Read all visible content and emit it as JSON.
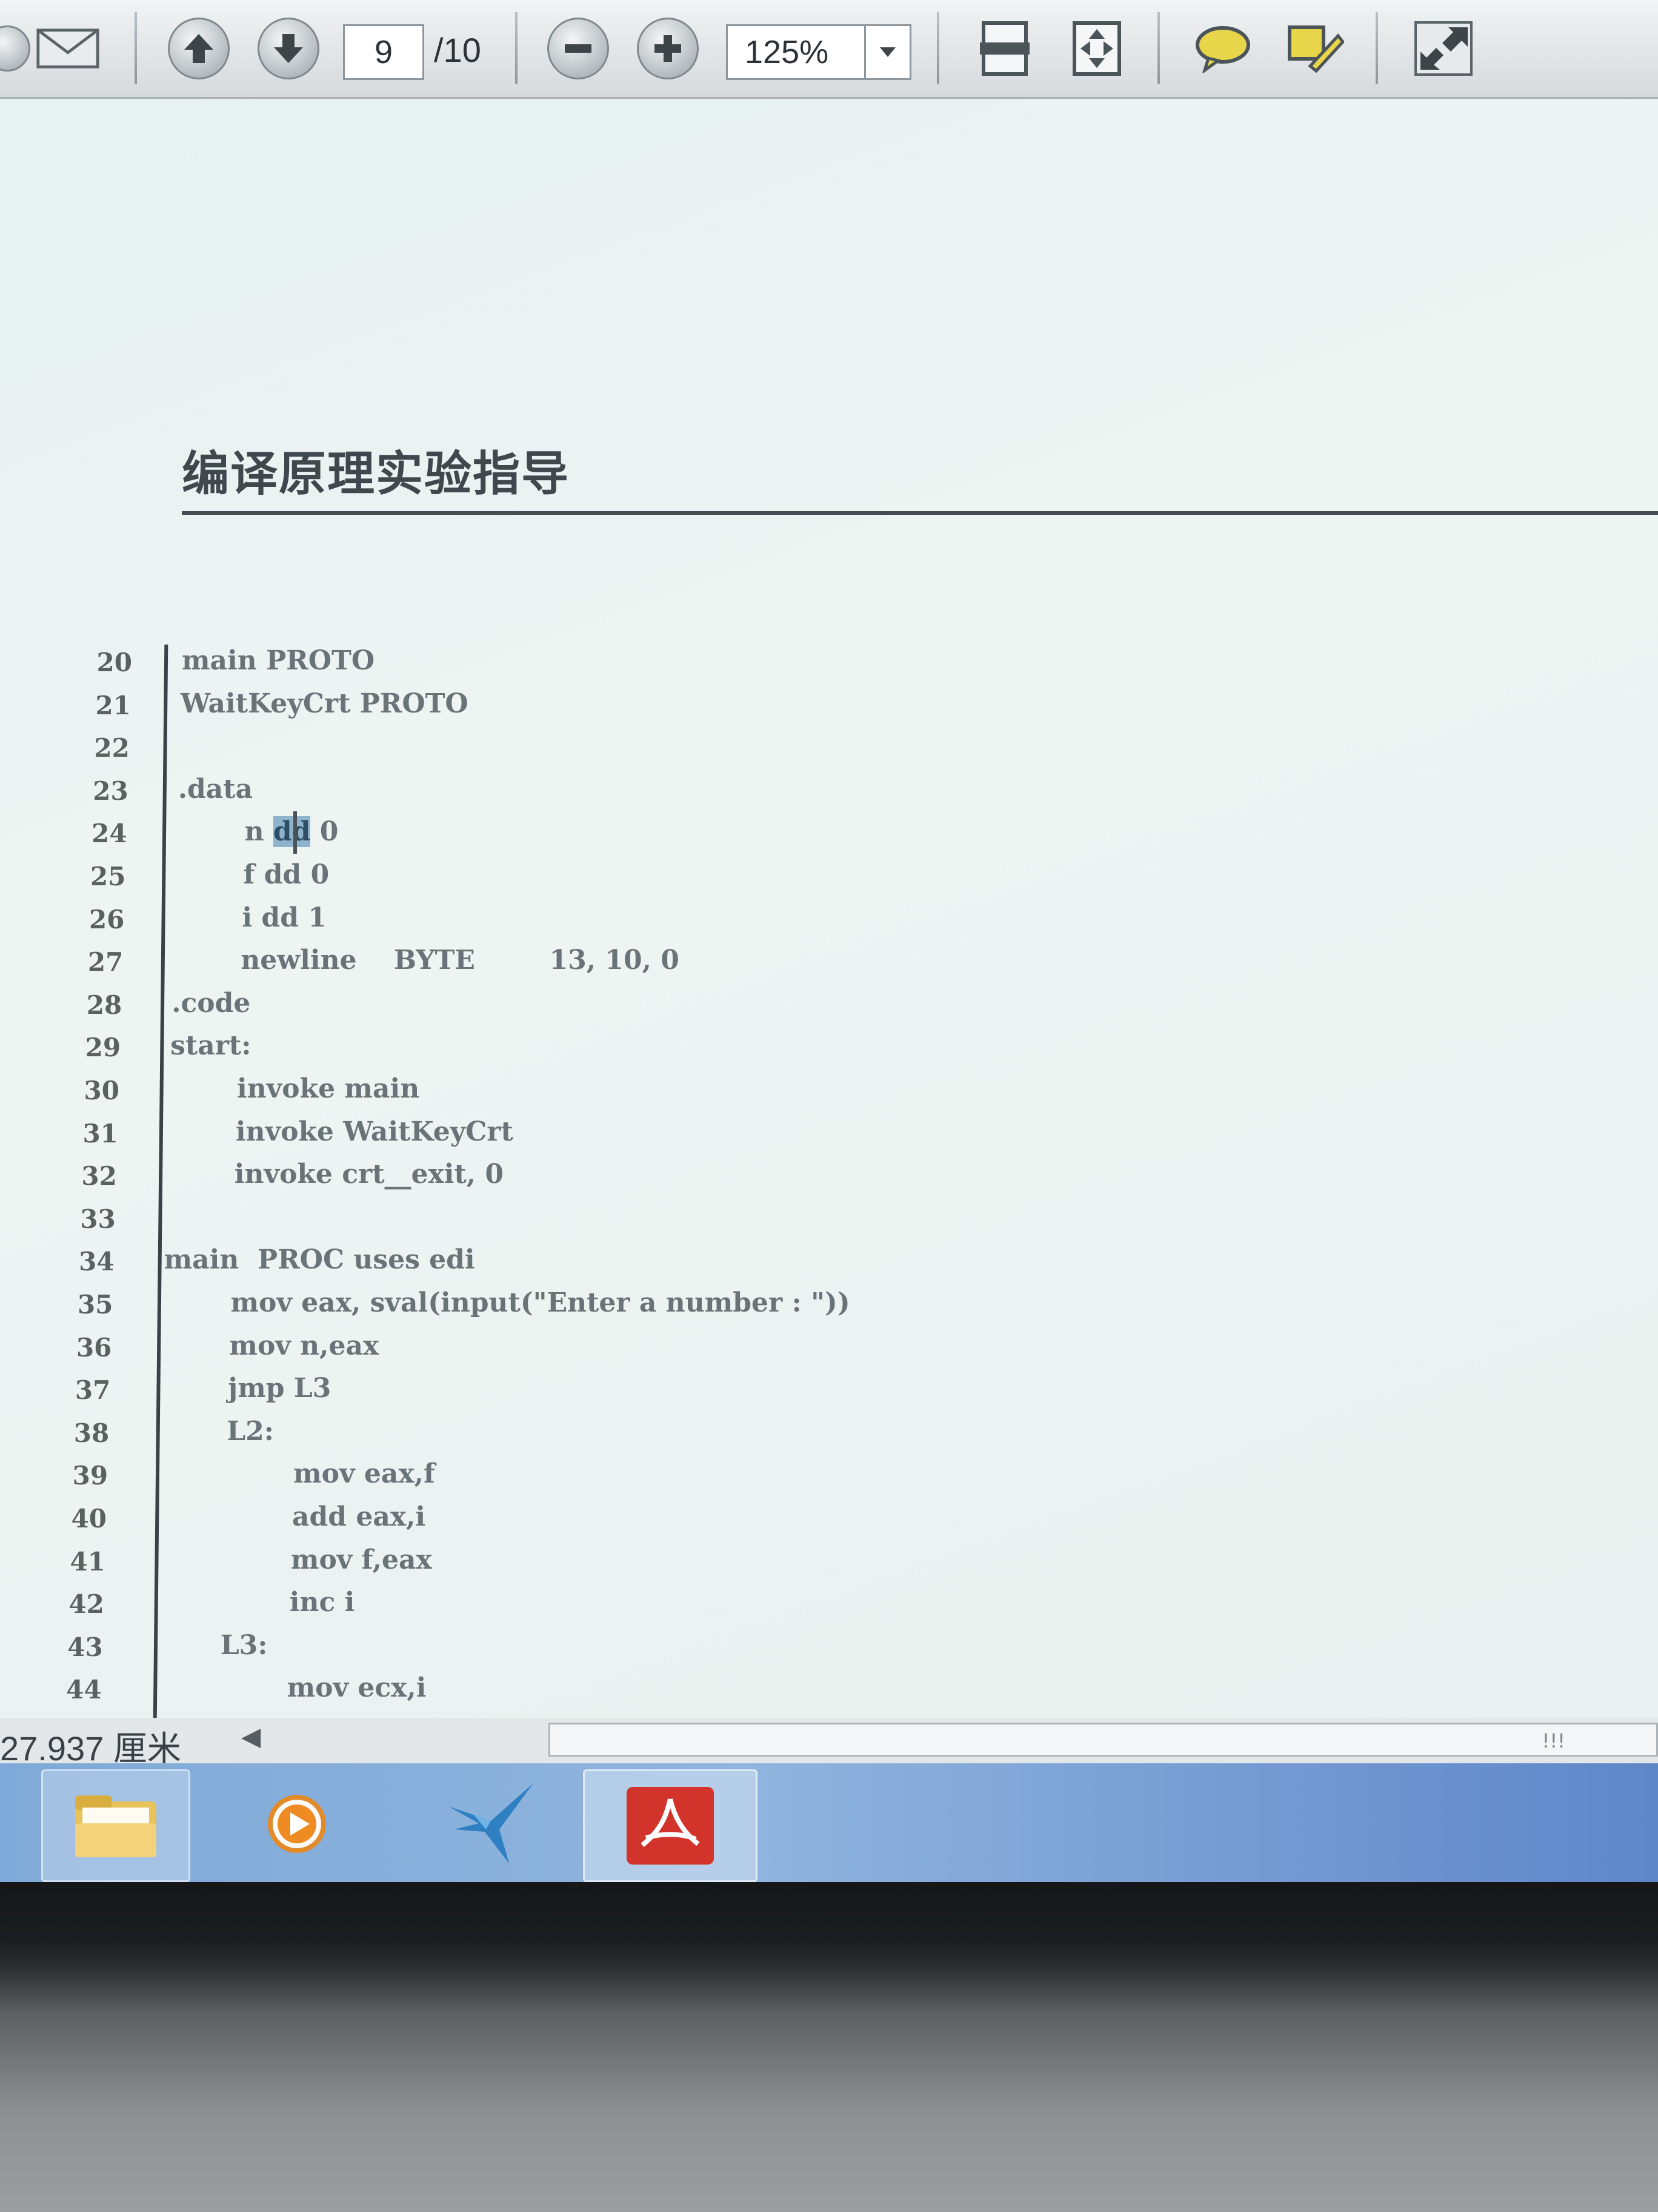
{
  "toolbar": {
    "page_current": "9",
    "page_total": "/10",
    "zoom": "125%",
    "icons": [
      "mail-icon",
      "page-up-icon",
      "page-down-icon",
      "zoom-out-icon",
      "zoom-in-icon",
      "fit-width-icon",
      "fit-page-icon",
      "comment-icon",
      "highlight-icon",
      "fullscreen-icon"
    ]
  },
  "document": {
    "header_title": "编译原理实验指导",
    "code_lines": [
      {
        "num": "20",
        "text": "main PROTO"
      },
      {
        "num": "21",
        "text": "WaitKeyCrt PROTO"
      },
      {
        "num": "22",
        "text": ""
      },
      {
        "num": "23",
        "text": ".data"
      },
      {
        "num": "24",
        "pre": "n ",
        "hl": "dd",
        "post": " 0"
      },
      {
        "num": "25",
        "text": "f dd 0"
      },
      {
        "num": "26",
        "text": "i dd 1"
      },
      {
        "num": "27",
        "text": "newline    BYTE        13, 10, 0"
      },
      {
        "num": "28",
        "text": ".code"
      },
      {
        "num": "29",
        "text": "start:"
      },
      {
        "num": "30",
        "text": "invoke main"
      },
      {
        "num": "31",
        "text": "invoke WaitKeyCrt"
      },
      {
        "num": "32",
        "text": "invoke crt__exit, 0"
      },
      {
        "num": "33",
        "text": ""
      },
      {
        "num": "34",
        "text": "main  PROC uses edi"
      },
      {
        "num": "35",
        "text": "mov eax, sval(input(\"Enter a number : \"))"
      },
      {
        "num": "36",
        "text": "mov n,eax"
      },
      {
        "num": "37",
        "text": "jmp L3"
      },
      {
        "num": "38",
        "text": "L2:"
      },
      {
        "num": "39",
        "text": "mov eax,f"
      },
      {
        "num": "40",
        "text": "add eax,i"
      },
      {
        "num": "41",
        "text": "mov f,eax"
      },
      {
        "num": "42",
        "text": "inc i"
      },
      {
        "num": "43",
        "text": "L3:"
      },
      {
        "num": "44",
        "text": "mov ecx,i"
      }
    ]
  },
  "status": {
    "page_size": "27.937 厘米",
    "scroll_grip": "!!!"
  },
  "taskbar": {
    "items": [
      "file-explorer-icon",
      "media-player-icon",
      "bird-app-icon",
      "pdf-reader-icon"
    ]
  }
}
